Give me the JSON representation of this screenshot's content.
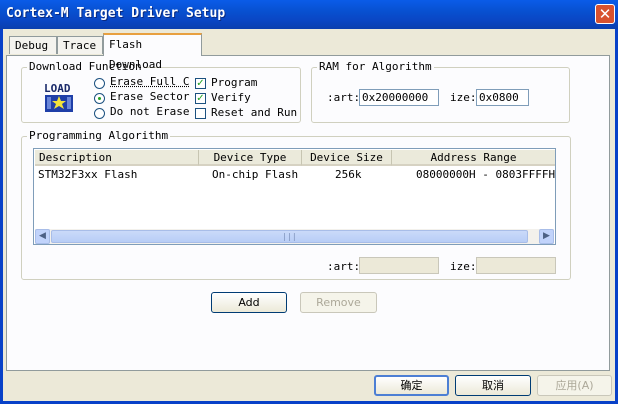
{
  "window": {
    "title": "Cortex-M Target Driver Setup",
    "close_glyph": "✕"
  },
  "tabs": [
    {
      "label": "Debug"
    },
    {
      "label": "Trace"
    },
    {
      "label": "Flash Download"
    }
  ],
  "download_function": {
    "legend": "Download Function",
    "load_icon_text": "LOAD",
    "radios": [
      {
        "label": "Erase Full C",
        "selected": false
      },
      {
        "label": "Erase Sector",
        "selected": true
      },
      {
        "label": "Do not Erase",
        "selected": false
      }
    ],
    "checks": [
      {
        "label": "Program",
        "checked": true
      },
      {
        "label": "Verify",
        "checked": true
      },
      {
        "label": "Reset and Run",
        "checked": false
      }
    ]
  },
  "ram": {
    "legend": "RAM for Algorithm",
    "start_label": ":art:",
    "start_value": "0x20000000",
    "size_label": "ize:",
    "size_value": "0x0800"
  },
  "programming": {
    "legend": "Programming Algorithm",
    "columns": [
      "Description",
      "Device Type",
      "Device Size",
      "Address Range"
    ],
    "rows": [
      {
        "description": "STM32F3xx Flash",
        "device_type": "On-chip Flash",
        "device_size": "256k",
        "address_range": "08000000H - 0803FFFFH"
      }
    ],
    "start_label": ":art:",
    "start_value": "",
    "size_label": "ize:",
    "size_value": "",
    "add_label": "Add",
    "remove_label": "Remove"
  },
  "footer": {
    "ok_label": "确定",
    "cancel_label": "取消",
    "apply_label": "应用(A)"
  }
}
